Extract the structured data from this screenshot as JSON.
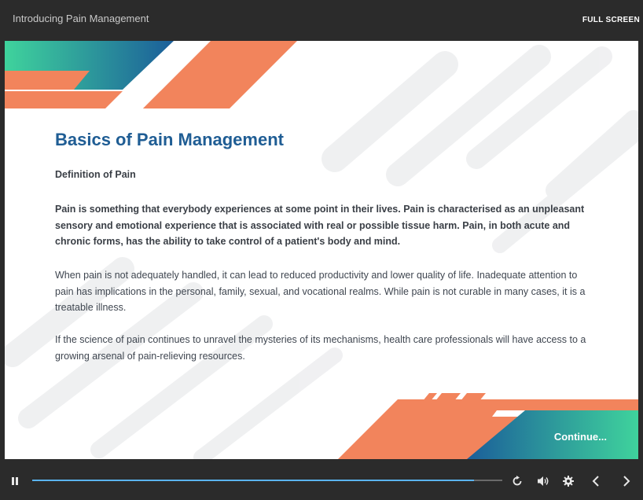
{
  "header": {
    "title": "Introducing Pain Management",
    "fullscreen_label": "FULL SCREEN"
  },
  "slide": {
    "heading": "Basics of Pain Management",
    "subheading": "Definition of Pain",
    "paragraphs": [
      "Pain is something that everybody experiences at some point in their lives. Pain is characterised as an unpleasant sensory and emotional experience that is associated with real or possible tissue harm. Pain, in both acute and chronic forms, has the ability to take control of a patient's body and mind.",
      "When pain is not adequately handled, it can lead to reduced productivity and lower quality of life. Inadequate attention to pain has implications in the personal, family, sexual, and vocational realms. While pain is not curable in many cases, it is a treatable illness.",
      "If the science of pain continues to unravel the mysteries of its mechanisms, health care professionals will have access to a growing arsenal of pain-relieving resources."
    ],
    "continue_label": "Continue..."
  },
  "player": {
    "progress_percent": 94,
    "icons": [
      "pause-icon",
      "replay-icon",
      "volume-icon",
      "settings-icon",
      "previous-icon",
      "next-icon"
    ]
  },
  "colors": {
    "chrome": "#2b2b2b",
    "heading": "#1f5d94",
    "accent_orange": "#f2845c",
    "accent_blue": "#1b5e9a",
    "accent_green": "#3fd39c",
    "progress": "#5ab3ef"
  }
}
